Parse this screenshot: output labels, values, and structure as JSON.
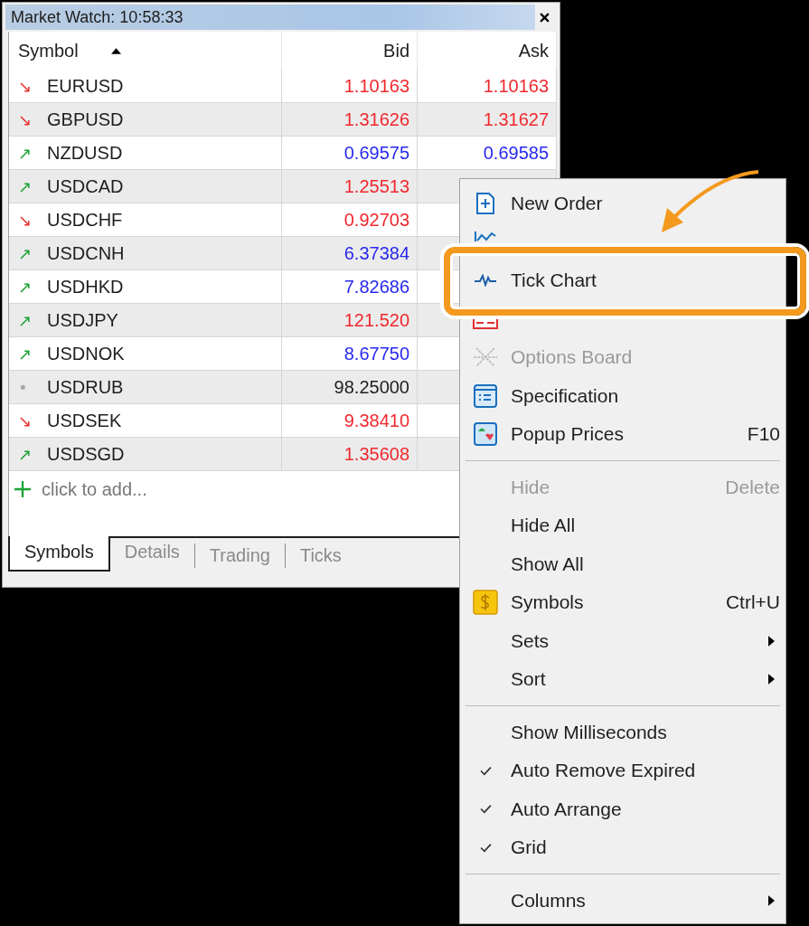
{
  "window": {
    "title": "Market Watch: 10:58:33"
  },
  "table": {
    "columns": [
      {
        "label": "Symbol",
        "sorted": true
      },
      {
        "label": "Bid",
        "sorted": false
      },
      {
        "label": "Ask",
        "sorted": false
      }
    ],
    "rows": [
      {
        "arrow": {
          "glyph": "↘",
          "color": "#e8302f"
        },
        "symbol": "EURUSD",
        "color": "#f0282d",
        "bid": "1.10163",
        "ask": "1.10163"
      },
      {
        "arrow": {
          "glyph": "↘",
          "color": "#e8302f"
        },
        "symbol": "GBPUSD",
        "color": "#f0282d",
        "bid": "1.31626",
        "ask": "1.31627"
      },
      {
        "arrow": {
          "glyph": "↗",
          "color": "#1aa334"
        },
        "symbol": "NZDUSD",
        "color": "#2828f0",
        "bid": "0.69575",
        "ask": "0.69585"
      },
      {
        "arrow": {
          "glyph": "↗",
          "color": "#1aa334"
        },
        "symbol": "USDCAD",
        "color": "#f0282d",
        "bid": "1.25513"
      },
      {
        "arrow": {
          "glyph": "↘",
          "color": "#e8302f"
        },
        "symbol": "USDCHF",
        "color": "#f0282d",
        "bid": "0.92703"
      },
      {
        "arrow": {
          "glyph": "↗",
          "color": "#1aa334"
        },
        "symbol": "USDCNH",
        "color": "#2828f0",
        "bid": "6.37384"
      },
      {
        "arrow": {
          "glyph": "↗",
          "color": "#1aa334"
        },
        "symbol": "USDHKD",
        "color": "#2828f0",
        "bid": "7.82686"
      },
      {
        "arrow": {
          "glyph": "↗",
          "color": "#1aa334"
        },
        "symbol": "USDJPY",
        "color": "#f0282d",
        "bid": "121.520"
      },
      {
        "arrow": {
          "glyph": "↗",
          "color": "#1aa334"
        },
        "symbol": "USDNOK",
        "color": "#2828f0",
        "bid": "8.67750"
      },
      {
        "arrow": {
          "glyph": "•",
          "color": "#a8a8a8"
        },
        "symbol": "USDRUB",
        "color": "#1e1e1e",
        "bid": "98.25000"
      },
      {
        "arrow": {
          "glyph": "↘",
          "color": "#e8302f"
        },
        "symbol": "USDSEK",
        "color": "#f0282d",
        "bid": "9.38410"
      },
      {
        "arrow": {
          "glyph": "↗",
          "color": "#1aa334"
        },
        "symbol": "USDSGD",
        "color": "#f0282d",
        "bid": "1.35608"
      }
    ],
    "add_row": {
      "placeholder": "click to add..."
    }
  },
  "tabs": [
    {
      "label": "Symbols",
      "selected": true
    },
    {
      "label": "Details",
      "selected": false
    },
    {
      "label": "Trading",
      "selected": false
    },
    {
      "label": "Ticks",
      "selected": false
    }
  ],
  "menu": {
    "items": [
      {
        "kind": "item",
        "label": "New Order",
        "disabled": false,
        "checked": false,
        "submenu": false
      },
      {
        "kind": "item",
        "checked": false,
        "submenu": false
      },
      {
        "kind": "item",
        "label": "Tick Chart",
        "disabled": false,
        "checked": false,
        "submenu": false,
        "highlighted": true
      },
      {
        "kind": "item",
        "checked": false,
        "submenu": false
      },
      {
        "kind": "item",
        "label": "Options Board",
        "disabled": true,
        "checked": false,
        "submenu": false
      },
      {
        "kind": "item",
        "label": "Specification",
        "disabled": false,
        "checked": false,
        "submenu": false
      },
      {
        "kind": "item",
        "label": "Popup Prices",
        "shortcut": "F10",
        "disabled": false,
        "checked": false,
        "submenu": false
      },
      {
        "kind": "separator"
      },
      {
        "kind": "item",
        "label": "Hide",
        "shortcut": "Delete",
        "disabled": true,
        "checked": false,
        "submenu": false
      },
      {
        "kind": "item",
        "label": "Hide All",
        "disabled": false,
        "checked": false,
        "submenu": false
      },
      {
        "kind": "item",
        "label": "Show All",
        "disabled": false,
        "checked": false,
        "submenu": false
      },
      {
        "kind": "item",
        "label": "Symbols",
        "shortcut": "Ctrl+U",
        "disabled": false,
        "checked": false,
        "submenu": false
      },
      {
        "kind": "item",
        "label": "Sets",
        "disabled": false,
        "checked": false,
        "submenu": true
      },
      {
        "kind": "item",
        "label": "Sort",
        "disabled": false,
        "checked": false,
        "submenu": true
      },
      {
        "kind": "separator"
      },
      {
        "kind": "item",
        "label": "Show Milliseconds",
        "disabled": false,
        "checked": false,
        "submenu": false
      },
      {
        "kind": "item",
        "label": "Auto Remove Expired",
        "disabled": false,
        "checked": true,
        "submenu": false
      },
      {
        "kind": "item",
        "label": "Auto Arrange",
        "disabled": false,
        "checked": true,
        "submenu": false
      },
      {
        "kind": "item",
        "label": "Grid",
        "disabled": false,
        "checked": true,
        "submenu": false
      },
      {
        "kind": "separator"
      },
      {
        "kind": "item",
        "label": "Columns",
        "disabled": false,
        "checked": false,
        "submenu": true
      }
    ]
  }
}
